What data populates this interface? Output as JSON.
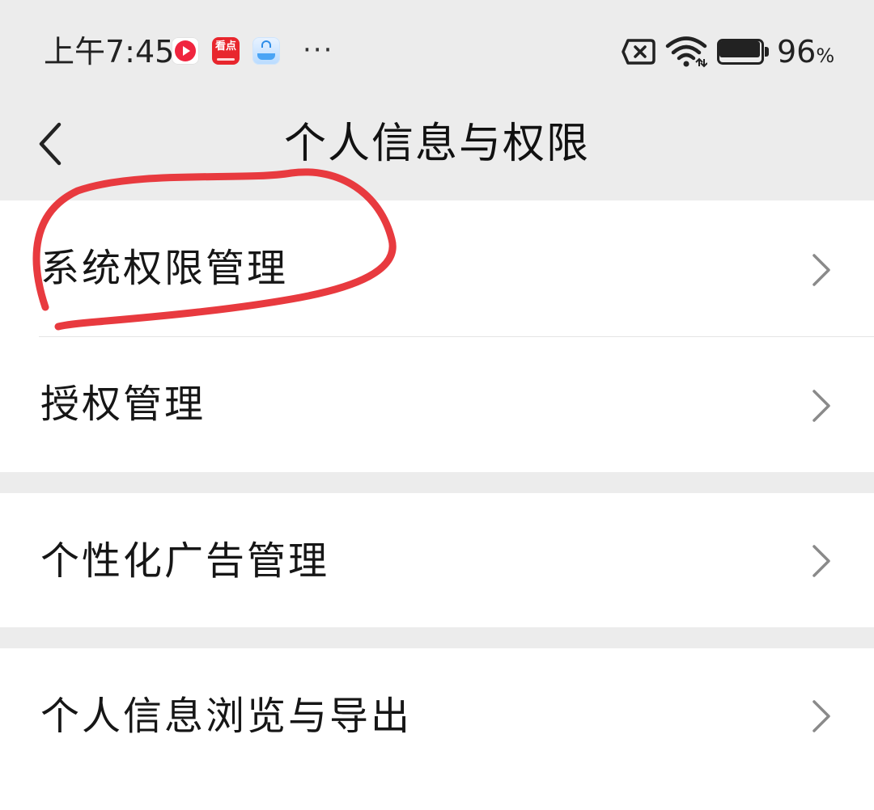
{
  "status_bar": {
    "time": "上午7:45",
    "more": "···",
    "app_icons": [
      "video-app-icon",
      "kandian-app-icon",
      "shopping-bag-app-icon"
    ],
    "kandian_text": "看点",
    "battery_value": "96",
    "battery_unit": "%",
    "battery_level": 0.96
  },
  "header": {
    "title": "个人信息与权限"
  },
  "menu": {
    "groups": [
      {
        "items": [
          {
            "label": "系统权限管理"
          },
          {
            "label": "授权管理"
          }
        ]
      },
      {
        "items": [
          {
            "label": "个性化广告管理"
          }
        ]
      },
      {
        "items": [
          {
            "label": "个人信息浏览与导出"
          }
        ]
      }
    ]
  },
  "colors": {
    "background": "#ececec",
    "card": "#ffffff",
    "text": "#161616",
    "chevron": "#8a8a8a",
    "annotation": "#e83a3f"
  }
}
